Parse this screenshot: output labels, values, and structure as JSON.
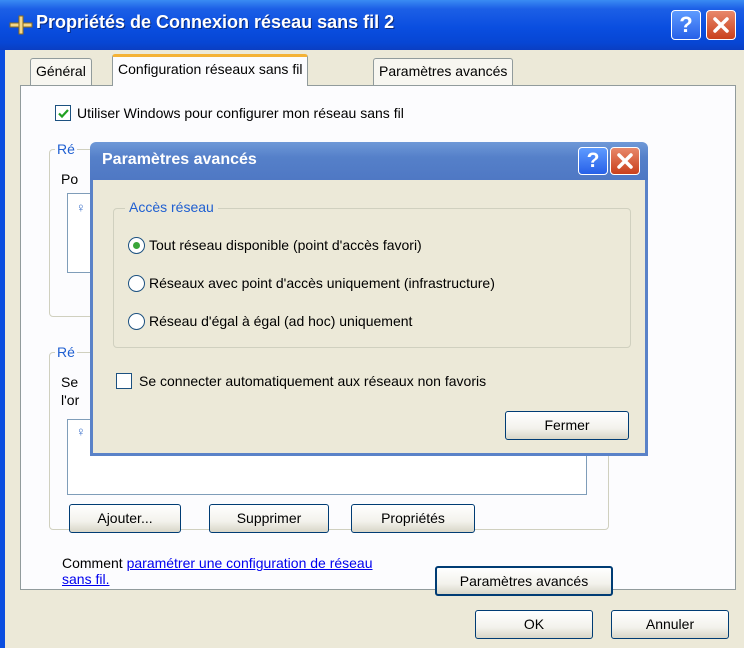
{
  "window": {
    "title": "Propriétés de Connexion réseau sans fil 2",
    "help_label": "?",
    "tabs": [
      {
        "label": "Général",
        "active": false
      },
      {
        "label": "Configuration réseaux sans fil",
        "active": true
      },
      {
        "label": "Paramètres avancés",
        "active": false
      }
    ]
  },
  "panel": {
    "use_windows_checkbox": {
      "label": "Utiliser Windows pour configurer mon réseau sans fil",
      "checked": true
    },
    "available_networks": {
      "title_partial": "Ré",
      "line1_partial": "Po"
    },
    "preferred_networks": {
      "title_partial": "Ré",
      "line1_partial": "Se",
      "line2_partial": "l'or"
    },
    "buttons": {
      "add": "Ajouter...",
      "remove": "Supprimer",
      "properties": "Propriétés"
    },
    "help_text": "Comment ",
    "help_link": "paramétrer une configuration de réseau sans fil.",
    "advanced_button": "Paramètres avancés"
  },
  "footer": {
    "ok": "OK",
    "cancel": "Annuler"
  },
  "dialog": {
    "title": "Paramètres avancés",
    "help_label": "?",
    "group_title": "Accès réseau",
    "options": [
      {
        "label": "Tout réseau disponible (point d'accès favori)",
        "selected": true
      },
      {
        "label": "Réseaux avec point d'accès uniquement (infrastructure)",
        "selected": false
      },
      {
        "label": "Réseau d'égal à égal (ad hoc) uniquement",
        "selected": false
      }
    ],
    "auto_connect": {
      "label": "Se connecter automatiquement aux réseaux non favoris",
      "checked": false
    },
    "close_button": "Fermer"
  },
  "colors": {
    "titlebar_blue": "#0a4ee0",
    "dialog_title_blue": "#5580c9",
    "close_red": "#c9401c",
    "window_bg": "#ece9d8",
    "link": "#0000ee",
    "radio_dot": "#3aa63a"
  }
}
